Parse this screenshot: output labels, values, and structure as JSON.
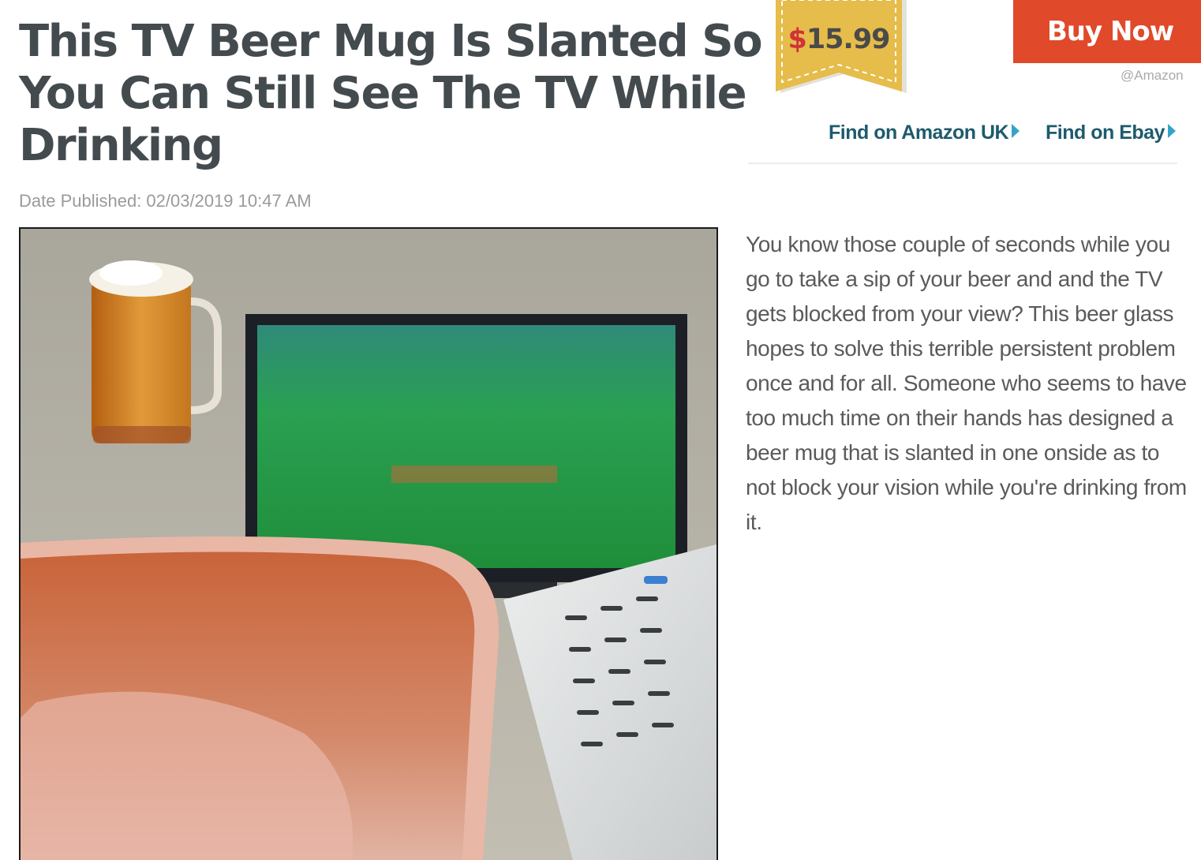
{
  "article": {
    "title": "This TV Beer Mug Is Slanted So You Can Still See The TV While Drinking",
    "date_published": "Date Published: 02/03/2019 10:47 AM",
    "description": "You know those couple of seconds while you go to take a sip of your beer and and the TV gets blocked from your view? This beer glass hopes to solve this terrible persistent problem once and for all. Someone who seems to have too much time on their hands has designed a beer mug that is slanted in one onside as to not block your vision while you're drinking from it."
  },
  "price": {
    "currency_symbol": "$",
    "amount": "15.99"
  },
  "buy": {
    "label": "Buy Now",
    "seller": "@Amazon"
  },
  "links": [
    {
      "label": "Find on Amazon UK",
      "icon": "triangle-right-icon"
    },
    {
      "label": "Find on Ebay",
      "icon": "triangle-right-icon"
    }
  ],
  "colors": {
    "title": "#444b4f",
    "buy_button": "#e0492a",
    "price_tag": "#e6bc4a",
    "currency": "#cf3339",
    "link": "#1e5a6e",
    "link_arrow": "#35a3c9"
  }
}
